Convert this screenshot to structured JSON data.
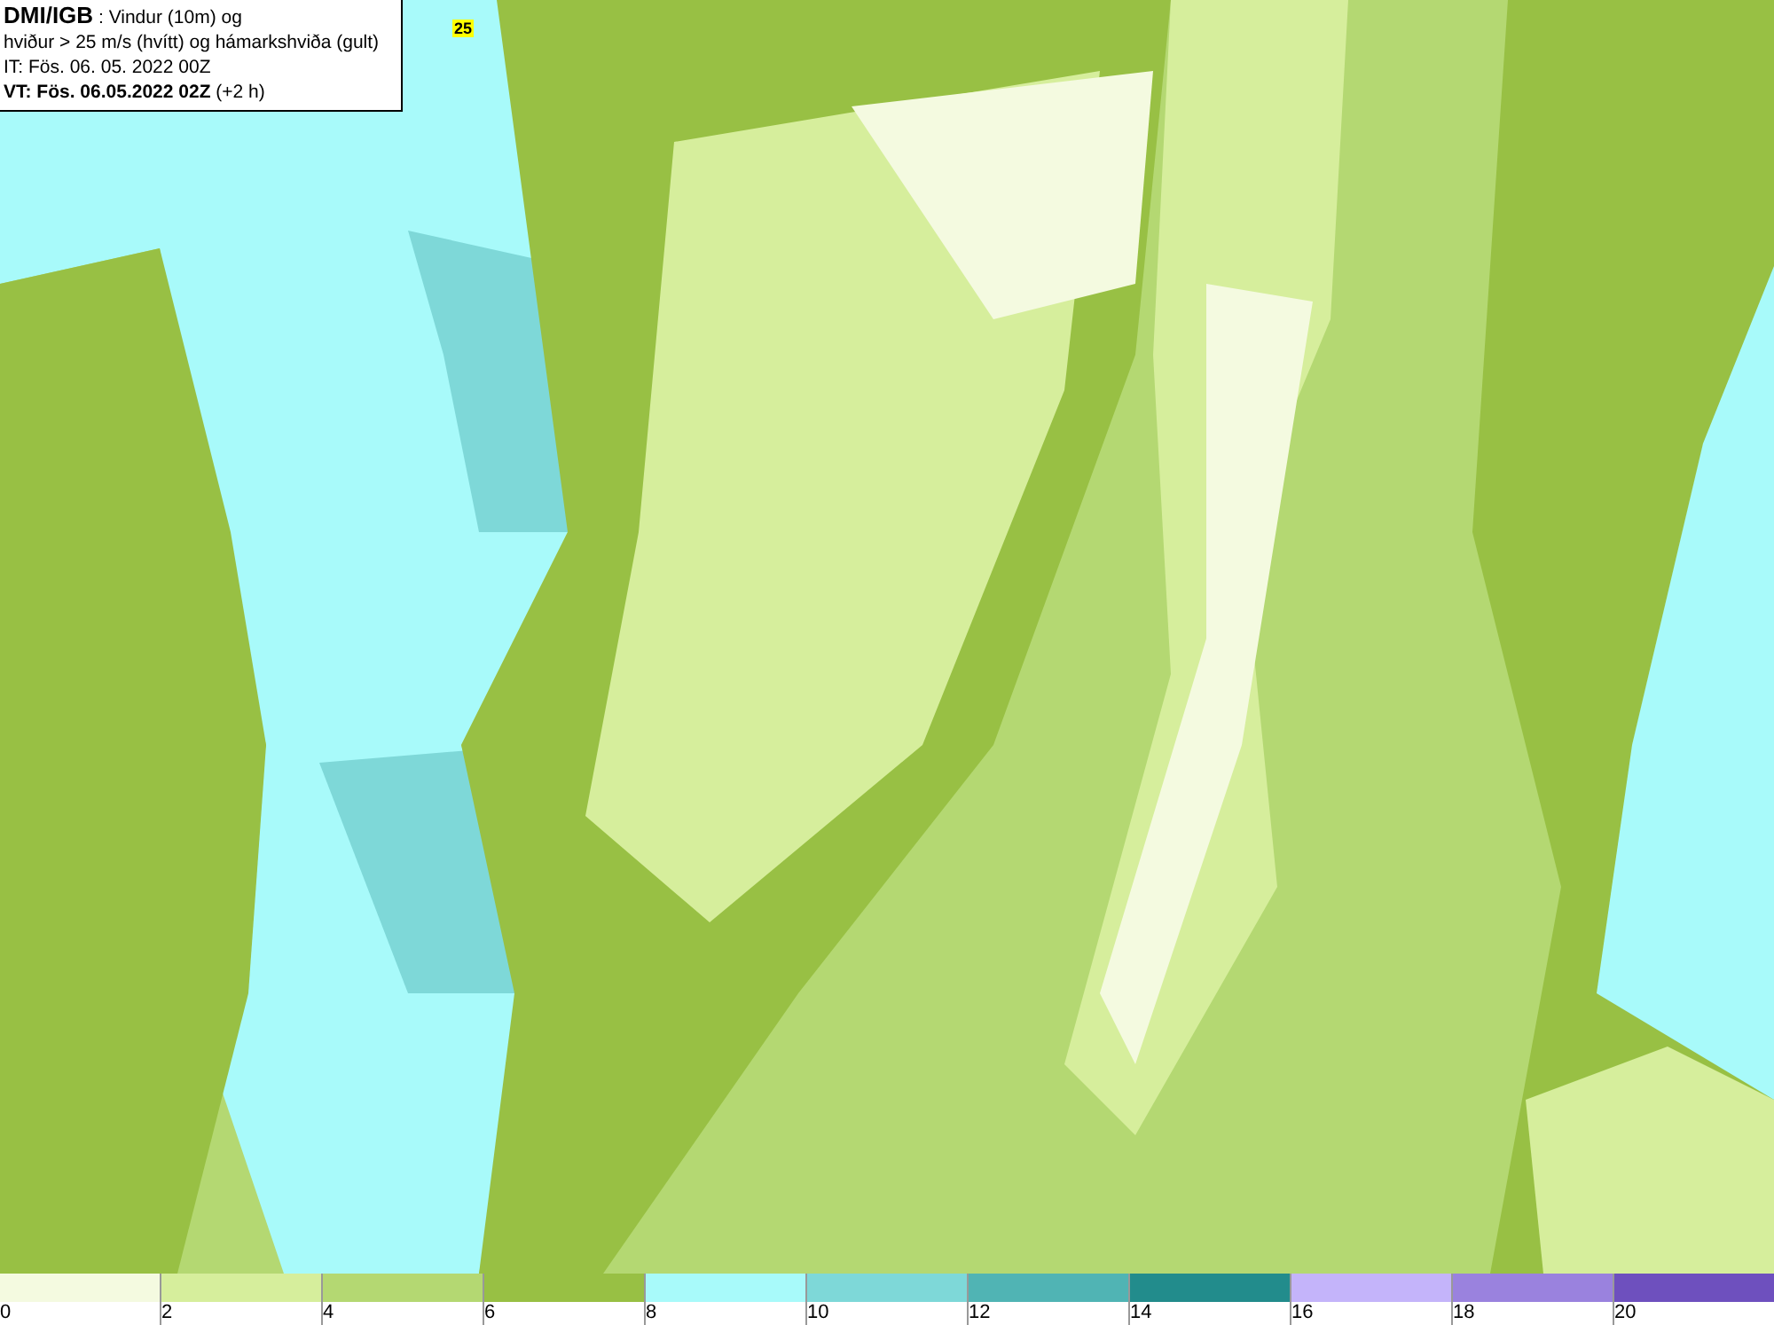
{
  "map": {
    "gust_label": "25"
  },
  "title_box": {
    "lines": [
      "**DMI/IGB** : Vindur (10m) og",
      "hviður > 25 m/s (hvítt) og hámarkshviða (gult)",
      "IT: Fös. 06. 05. 2022 00Z",
      "**VT: Fös. 06.05.2022 02Z** (+2 h)"
    ]
  },
  "legend": [
    {
      "label": "0",
      "color": "#f4fae0"
    },
    {
      "label": "2",
      "color": "#d6ee9c"
    },
    {
      "label": "4",
      "color": "#b4d872"
    },
    {
      "label": "6",
      "color": "#98c044"
    },
    {
      "label": "8",
      "color": "#a8fafa"
    },
    {
      "label": "10",
      "color": "#7ed8d8"
    },
    {
      "label": "12",
      "color": "#50b4b4"
    },
    {
      "label": "14",
      "color": "#228c8c"
    },
    {
      "label": "16",
      "color": "#c4b4fa"
    },
    {
      "label": "18",
      "color": "#9a82de"
    },
    {
      "label": "20",
      "color": "#6e50be"
    }
  ]
}
